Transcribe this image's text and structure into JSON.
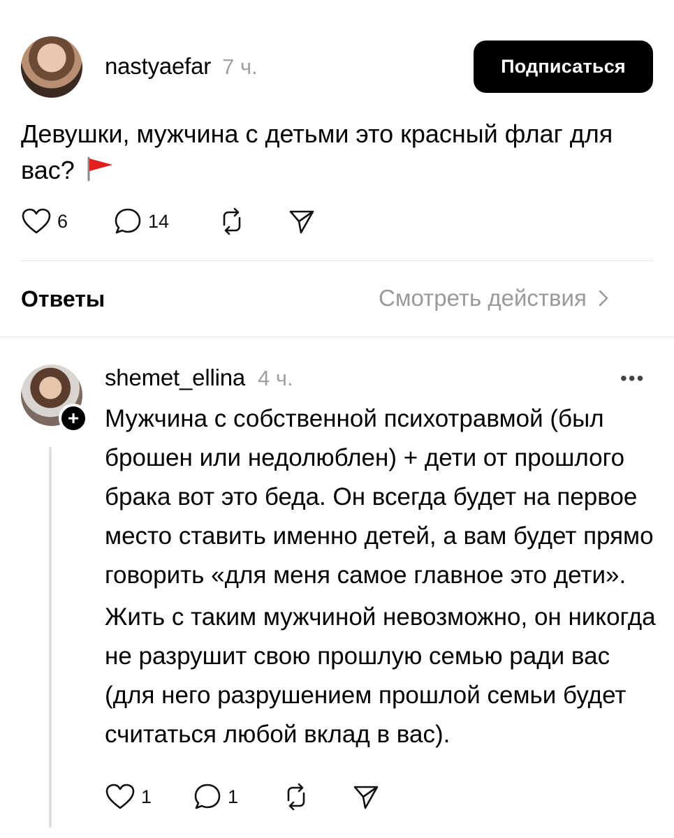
{
  "post": {
    "author": "nastyaefar",
    "time": "7 ч.",
    "follow_label": "Подписаться",
    "text": "Девушки, мужчина с детьми это красный флаг для вас?",
    "likes": "6",
    "comments": "14"
  },
  "replies_section": {
    "title": "Ответы",
    "activity_label": "Смотреть действия"
  },
  "reply": {
    "author": "shemet_ellina",
    "time": "4 ч.",
    "more": "•••",
    "paragraph1": "Мужчина с собственной психотравмой (был брошен или недолюблен) + дети от прошлого брака вот это беда. Он всегда будет на первое место ставить именно детей, а вам будет прямо говорить «для меня самое главное это дети».",
    "paragraph2": "Жить с таким мужчиной невозможно, он никогда не разрушит свою прошлую семью ради вас (для него разрушением прошлой семьи будет считаться любой вклад в вас).",
    "likes": "1",
    "comments": "1"
  },
  "icons": {
    "like": "heart-icon",
    "comment": "comment-icon",
    "repost": "repost-icon",
    "share": "share-icon",
    "flag": "red-flag-icon",
    "chevron": "chevron-right-icon",
    "follow_plus": "plus-icon"
  },
  "colors": {
    "flag_red": "#e0201c",
    "muted_text": "#9a9a9a",
    "button_bg": "#000000"
  }
}
